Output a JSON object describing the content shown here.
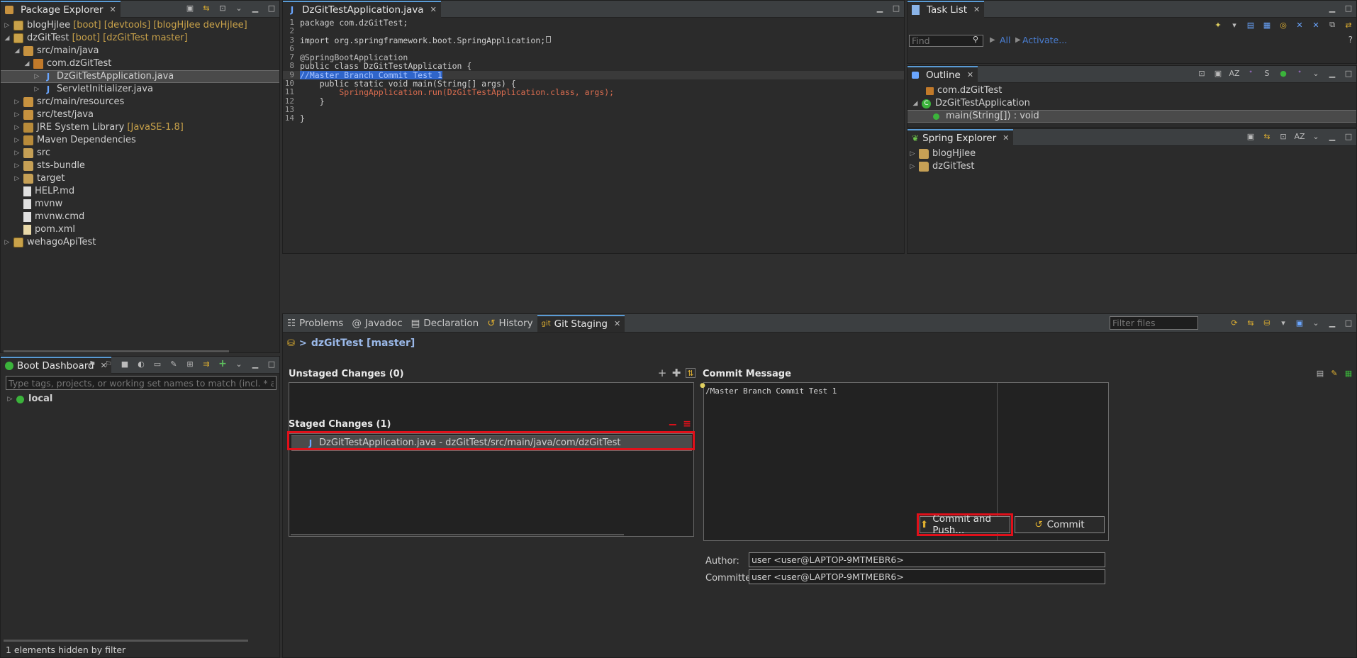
{
  "package_explorer": {
    "title": "Package Explorer",
    "items": [
      {
        "label": "blogHjlee",
        "decoration": "[boot] [devtools] [blogHjlee devHjlee]"
      },
      {
        "label": "dzGitTest",
        "decoration": "[boot] [dzGitTest master]"
      },
      {
        "label": "src/main/java"
      },
      {
        "label": "com.dzGitTest"
      },
      {
        "label": "DzGitTestApplication.java"
      },
      {
        "label": "ServletInitializer.java"
      },
      {
        "label": "src/main/resources"
      },
      {
        "label": "src/test/java"
      },
      {
        "label": "JRE System Library",
        "decoration": "[JavaSE-1.8]"
      },
      {
        "label": "Maven Dependencies"
      },
      {
        "label": "src"
      },
      {
        "label": "sts-bundle"
      },
      {
        "label": "target"
      },
      {
        "label": "HELP.md"
      },
      {
        "label": "mvnw"
      },
      {
        "label": "mvnw.cmd"
      },
      {
        "label": "pom.xml"
      },
      {
        "label": "wehagoApiTest"
      }
    ]
  },
  "boot_dashboard": {
    "title": "Boot Dashboard",
    "filter_placeholder": "Type tags, projects, or working set names to match (incl. * and ? wildcard",
    "items": [
      {
        "label": "local"
      }
    ],
    "status": "1 elements hidden by filter"
  },
  "editor": {
    "tab_title": "DzGitTestApplication.java",
    "lines": [
      {
        "n": "1",
        "t": "package com.dzGitTest;"
      },
      {
        "n": "2",
        "t": ""
      },
      {
        "n": "3",
        "t": "import org.springframework.boot.SpringApplication;"
      },
      {
        "n": "6",
        "t": ""
      },
      {
        "n": "7",
        "t": "@SpringBootApplication"
      },
      {
        "n": "8",
        "t": "public class DzGitTestApplication {"
      },
      {
        "n": "9",
        "t": "//Master Branch Commit Test 1"
      },
      {
        "n": "10",
        "t": "    public static void main(String[] args) {"
      },
      {
        "n": "11",
        "t": "        SpringApplication.run(DzGitTestApplication.class, args);"
      },
      {
        "n": "12",
        "t": "    }"
      },
      {
        "n": "13",
        "t": ""
      },
      {
        "n": "14",
        "t": "}"
      }
    ]
  },
  "task_list": {
    "title": "Task List",
    "find_placeholder": "Find",
    "all_label": "All",
    "activate_label": "Activate..."
  },
  "outline": {
    "title": "Outline",
    "items": [
      {
        "label": "com.dzGitTest"
      },
      {
        "label": "DzGitTestApplication"
      },
      {
        "label": "main(String[]) : void"
      }
    ]
  },
  "spring_explorer": {
    "title": "Spring Explorer",
    "items": [
      {
        "label": "blogHjlee"
      },
      {
        "label": "dzGitTest"
      }
    ]
  },
  "bottom_tabs": {
    "problems": "Problems",
    "javadoc": "Javadoc",
    "declaration": "Declaration",
    "history": "History",
    "git_staging": "Git Staging",
    "filter_placeholder": "Filter files"
  },
  "git_staging": {
    "repo": "dzGitTest [master]",
    "unstaged_title": "Unstaged Changes (0)",
    "staged_title": "Staged Changes (1)",
    "staged_file": "DzGitTestApplication.java - dzGitTest/src/main/java/com/dzGitTest",
    "commit_message_title": "Commit Message",
    "commit_message": "/Master Branch Commit Test 1",
    "author_label": "Author:",
    "author_value": "user <user@LAPTOP-9MTMEBR6>",
    "committer_label": "Committer:",
    "committer_value": "user <user@LAPTOP-9MTMEBR6>",
    "commit_push_label": "Commit and Push...",
    "commit_label": "Commit"
  },
  "colors": {
    "highlight": "#e0101a",
    "accent": "#5a9bd5"
  }
}
